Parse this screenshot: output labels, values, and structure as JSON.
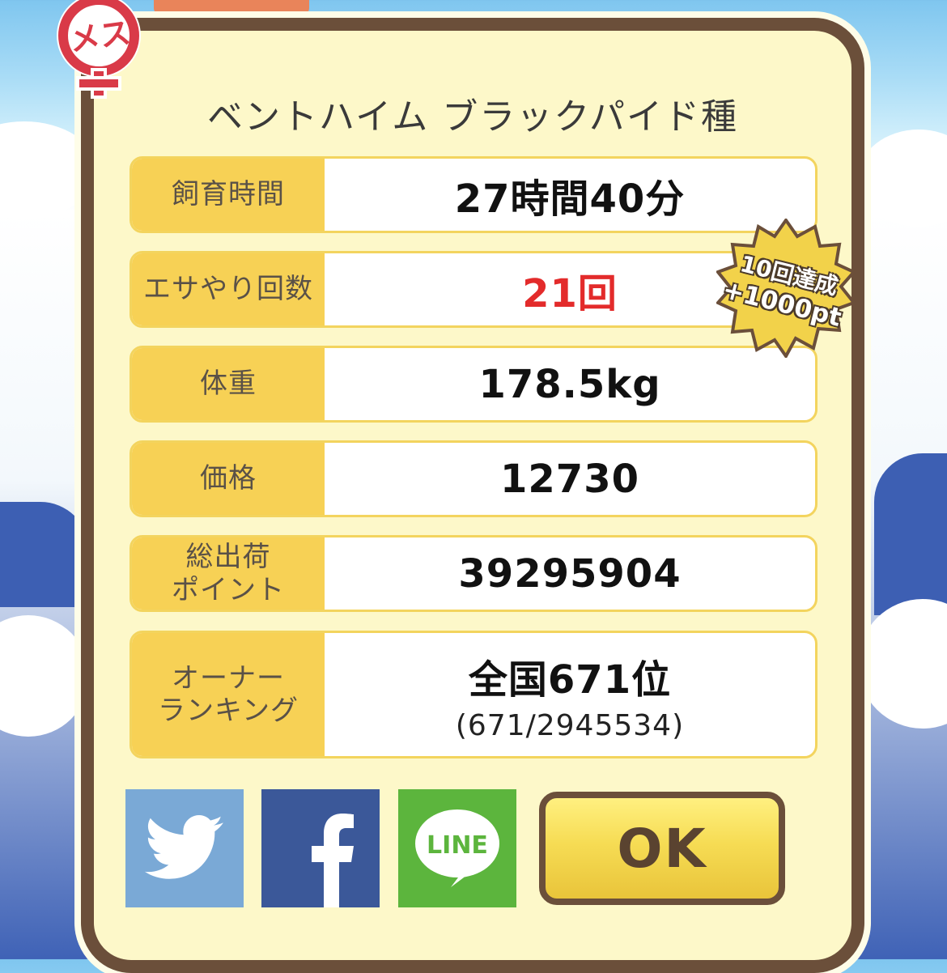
{
  "sex_badge": "メス",
  "title": "ベントハイム ブラックパイド種",
  "rows": [
    {
      "label": "飼育時間",
      "value": "27時間40分"
    },
    {
      "label": "エサやり回数",
      "value": "21回"
    },
    {
      "label": "体重",
      "value": "178.5kg"
    },
    {
      "label": "価格",
      "value": "12730"
    },
    {
      "label": "総出荷\nポイント",
      "value": "39295904"
    },
    {
      "label": "オーナー\nランキング",
      "value": "全国671位",
      "sub": "(671/2945534)"
    }
  ],
  "badge": {
    "line1": "10回達成",
    "line2": "+1000pt"
  },
  "social": {
    "twitter": "twitter-icon",
    "facebook": "facebook-icon",
    "line": "LINE"
  },
  "ok_label": "OK",
  "colors": {
    "panel_bg": "#fdf8c9",
    "panel_border": "#6b4f3a",
    "label_bg": "#f7d155",
    "highlight": "#e32b2b",
    "twitter": "#7aa9d6",
    "facebook": "#3b5899",
    "line": "#5cb53d"
  }
}
